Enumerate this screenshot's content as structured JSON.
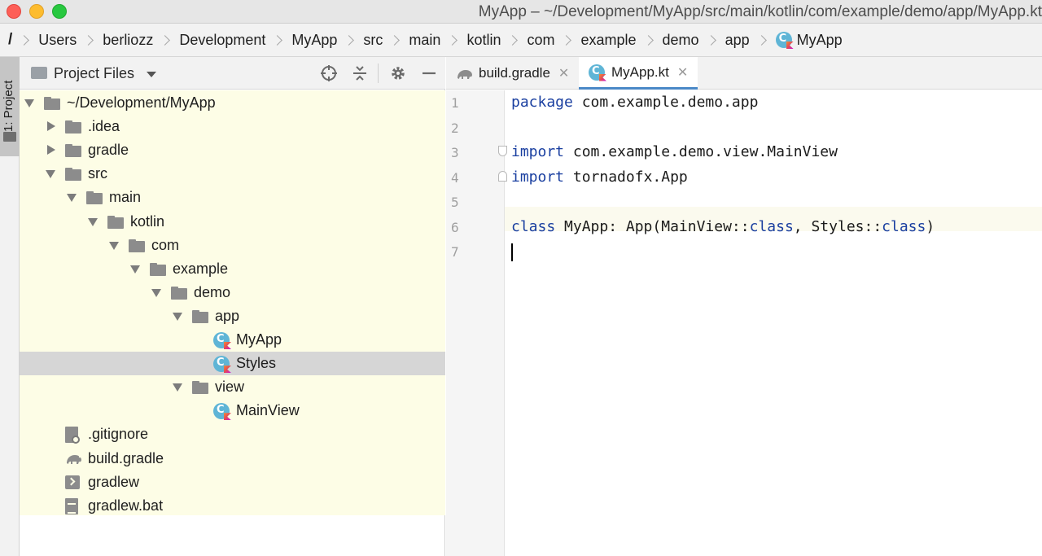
{
  "window": {
    "title": "MyApp – ~/Development/MyApp/src/main/kotlin/com/example/demo/app/MyApp.kt"
  },
  "breadcrumb": {
    "items": [
      "/",
      "Users",
      "berliozz",
      "Development",
      "MyApp",
      "src",
      "main",
      "kotlin",
      "com",
      "example",
      "demo",
      "app",
      "MyApp"
    ]
  },
  "toolstrip": {
    "project_label": "1: Project"
  },
  "project_panel": {
    "title": "Project Files",
    "tree": [
      {
        "label": "~/Development/MyApp",
        "type": "folder",
        "expanded": true,
        "level": 0
      },
      {
        "label": ".idea",
        "type": "folder",
        "expanded": false,
        "level": 1
      },
      {
        "label": "gradle",
        "type": "folder",
        "expanded": false,
        "level": 1
      },
      {
        "label": "src",
        "type": "folder",
        "expanded": true,
        "level": 1
      },
      {
        "label": "main",
        "type": "folder",
        "expanded": true,
        "level": 2
      },
      {
        "label": "kotlin",
        "type": "folder",
        "expanded": true,
        "level": 3
      },
      {
        "label": "com",
        "type": "folder",
        "expanded": true,
        "level": 4
      },
      {
        "label": "example",
        "type": "folder",
        "expanded": true,
        "level": 5
      },
      {
        "label": "demo",
        "type": "folder",
        "expanded": true,
        "level": 6
      },
      {
        "label": "app",
        "type": "folder",
        "expanded": true,
        "level": 7
      },
      {
        "label": "MyApp",
        "type": "kotlin-class",
        "level": 8
      },
      {
        "label": "Styles",
        "type": "kotlin-class",
        "level": 8,
        "selected": true
      },
      {
        "label": "view",
        "type": "folder",
        "expanded": true,
        "level": 7
      },
      {
        "label": "MainView",
        "type": "kotlin-class",
        "level": 8
      },
      {
        "label": ".gitignore",
        "type": "gitignore",
        "level": 1
      },
      {
        "label": "build.gradle",
        "type": "gradle",
        "level": 1
      },
      {
        "label": "gradlew",
        "type": "script",
        "level": 1
      },
      {
        "label": "gradlew.bat",
        "type": "text",
        "level": 1
      }
    ]
  },
  "editor": {
    "tabs": [
      {
        "label": "build.gradle",
        "icon": "gradle-icon",
        "active": false
      },
      {
        "label": "MyApp.kt",
        "icon": "kotlin-class-icon",
        "active": true
      }
    ],
    "close_glyph": "✕",
    "lines": [
      {
        "num": "1",
        "tokens": [
          {
            "t": "package",
            "k": true
          },
          {
            "t": " com.example.demo.app",
            "k": false
          }
        ]
      },
      {
        "num": "2",
        "tokens": []
      },
      {
        "num": "3",
        "tokens": [
          {
            "t": "import",
            "k": true
          },
          {
            "t": " com.example.demo.view.MainView",
            "k": false
          }
        ]
      },
      {
        "num": "4",
        "tokens": [
          {
            "t": "import",
            "k": true
          },
          {
            "t": " tornadofx.App",
            "k": false
          }
        ]
      },
      {
        "num": "5",
        "tokens": []
      },
      {
        "num": "6",
        "tokens": [
          {
            "t": "class",
            "k": true
          },
          {
            "t": " MyApp: App(MainView::",
            "k": false
          },
          {
            "t": "class",
            "k": true
          },
          {
            "t": ", Styles::",
            "k": false
          },
          {
            "t": "class",
            "k": true
          },
          {
            "t": ")",
            "k": false
          }
        ]
      },
      {
        "num": "7",
        "tokens": []
      }
    ]
  },
  "colors": {
    "keyword": "#1a3fa0",
    "tree_background": "#fdfde6",
    "selection": "#d6d6d6",
    "active_tab_underline": "#4a88c7"
  }
}
